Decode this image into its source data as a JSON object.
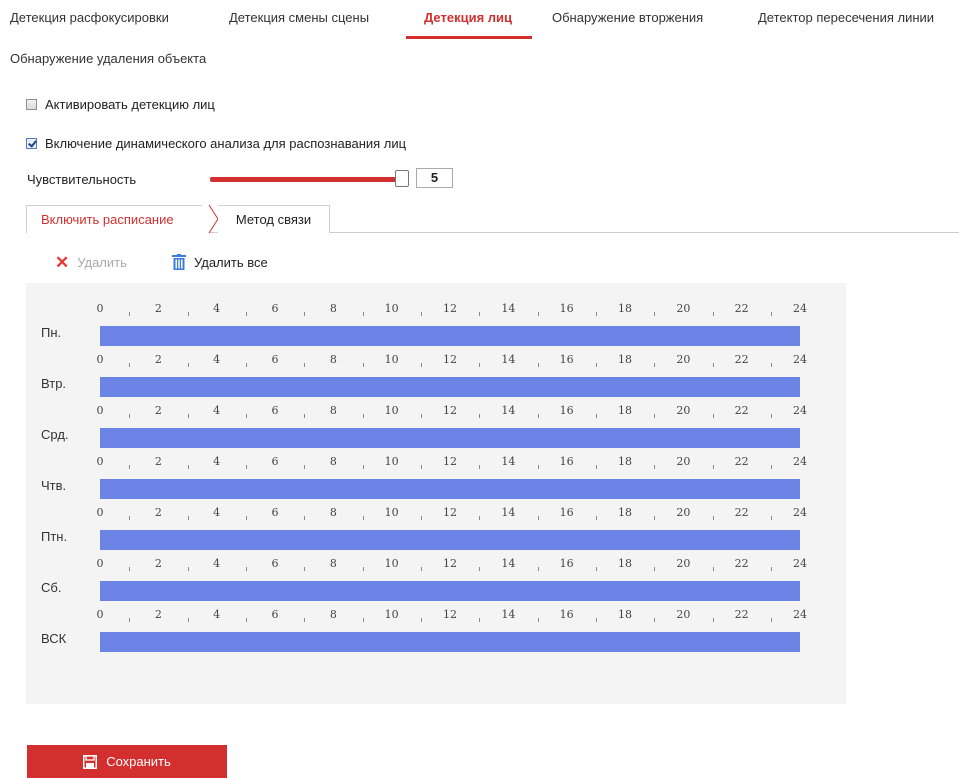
{
  "tabs": [
    {
      "label": "Детекция расфокусировки",
      "active": false
    },
    {
      "label": "Детекция смены сцены",
      "active": false
    },
    {
      "label": "Детекция лиц",
      "active": true
    },
    {
      "label": "Обнаружение вторжения",
      "active": false
    },
    {
      "label": "Детектор пересечения линии",
      "active": false
    },
    {
      "label": "Обнаружение удаления объекта",
      "active": false
    }
  ],
  "options": {
    "enable_face_detection": {
      "label": "Активировать детекцию лиц",
      "checked": false
    },
    "dynamic_analysis": {
      "label": "Включение динамического анализа для распознавания лиц",
      "checked": true
    }
  },
  "sensitivity": {
    "label": "Чувствительность",
    "value": "5",
    "level": 1.0
  },
  "subtabs": [
    {
      "label": "Включить расписание",
      "active": true
    },
    {
      "label": "Метод связи",
      "active": false
    }
  ],
  "toolbar": {
    "delete_label": "Удалить",
    "delete_all_label": "Удалить все"
  },
  "schedule": {
    "hour_ticks": [
      "0",
      "2",
      "4",
      "6",
      "8",
      "10",
      "12",
      "14",
      "16",
      "18",
      "20",
      "22",
      "24"
    ],
    "days": [
      {
        "label": "Пн.",
        "start": 0,
        "end": 24
      },
      {
        "label": "Втр.",
        "start": 0,
        "end": 24
      },
      {
        "label": "Срд.",
        "start": 0,
        "end": 24
      },
      {
        "label": "Чтв.",
        "start": 0,
        "end": 24
      },
      {
        "label": "Птн.",
        "start": 0,
        "end": 24
      },
      {
        "label": "Сб.",
        "start": 0,
        "end": 24
      },
      {
        "label": "ВСК",
        "start": 0,
        "end": 24
      }
    ]
  },
  "save_label": "Сохранить",
  "colors": {
    "accent": "#d32f2f",
    "schedule_bar": "#6b84e6"
  }
}
